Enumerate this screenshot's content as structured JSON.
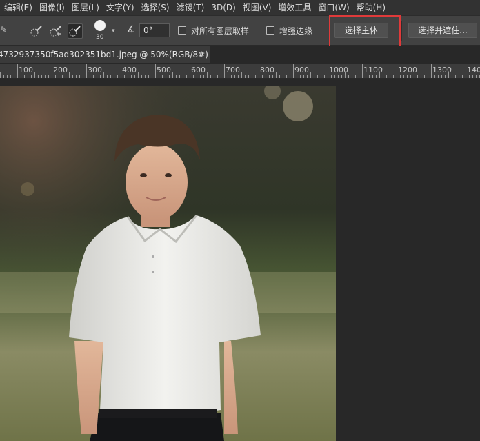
{
  "menu": [
    "编辑(E)",
    "图像(I)",
    "图层(L)",
    "文字(Y)",
    "选择(S)",
    "滤镜(T)",
    "3D(D)",
    "视图(V)",
    "增效工具",
    "窗口(W)",
    "帮助(H)"
  ],
  "options": {
    "brush_size": "30",
    "angle_value": "0°",
    "sample_all_layers_label": "对所有图层取样",
    "enhance_edge_label": "增强边缘",
    "select_subject_label": "选择主体",
    "select_and_mask_label": "选择并遮住..."
  },
  "tab": {
    "title": "4732937350f5ad302351bd1.jpeg @ 50%(RGB/8#)",
    "close": "×"
  },
  "ruler": {
    "labels": [
      "100",
      "200",
      "300",
      "400",
      "500",
      "600",
      "700",
      "800",
      "900",
      "1000",
      "1100",
      "1200",
      "1300",
      "140"
    ]
  },
  "colors": {
    "highlight": "#e03a3a",
    "panel": "#424242",
    "background": "#282828"
  },
  "icons": [
    "quick-selection-add-icon",
    "quick-selection-subtract-icon",
    "quick-selection-brush-icon",
    "angle-icon",
    "close-icon"
  ]
}
